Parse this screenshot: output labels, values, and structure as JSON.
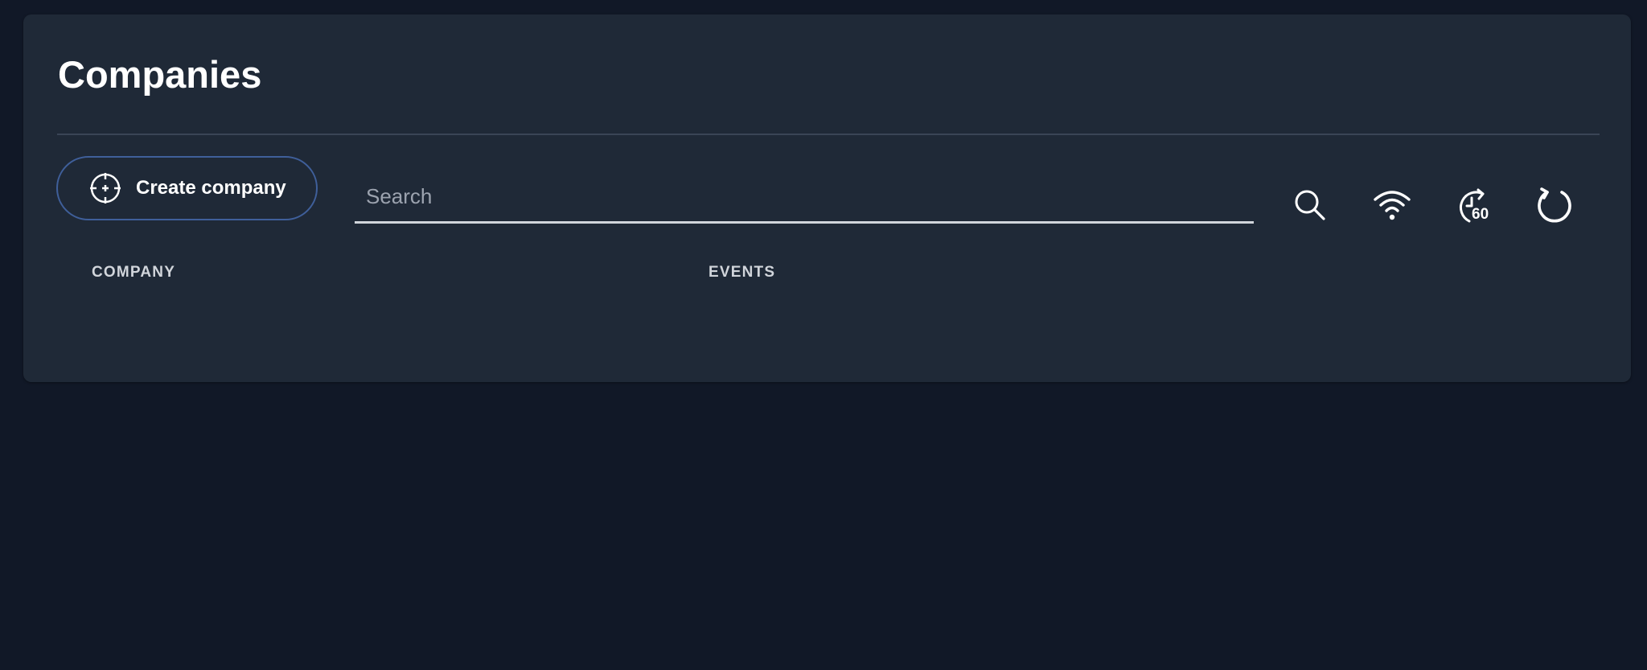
{
  "page": {
    "title": "Companies"
  },
  "toolbar": {
    "create_label": "Create company",
    "create_icon": "crosshair-plus-icon",
    "search_placeholder": "Search",
    "search_value": "",
    "icons": [
      "search-icon",
      "wifi-icon",
      "auto-refresh-60-icon",
      "refresh-icon"
    ],
    "auto_refresh_interval": "60"
  },
  "table": {
    "columns": [
      "COMPANY",
      "EVENTS"
    ],
    "rows": []
  },
  "colors": {
    "background": "#111827",
    "card": "#1f2937",
    "button_border": "#3f5f9a",
    "text_primary": "#ffffff",
    "text_muted": "#d1d5db"
  }
}
